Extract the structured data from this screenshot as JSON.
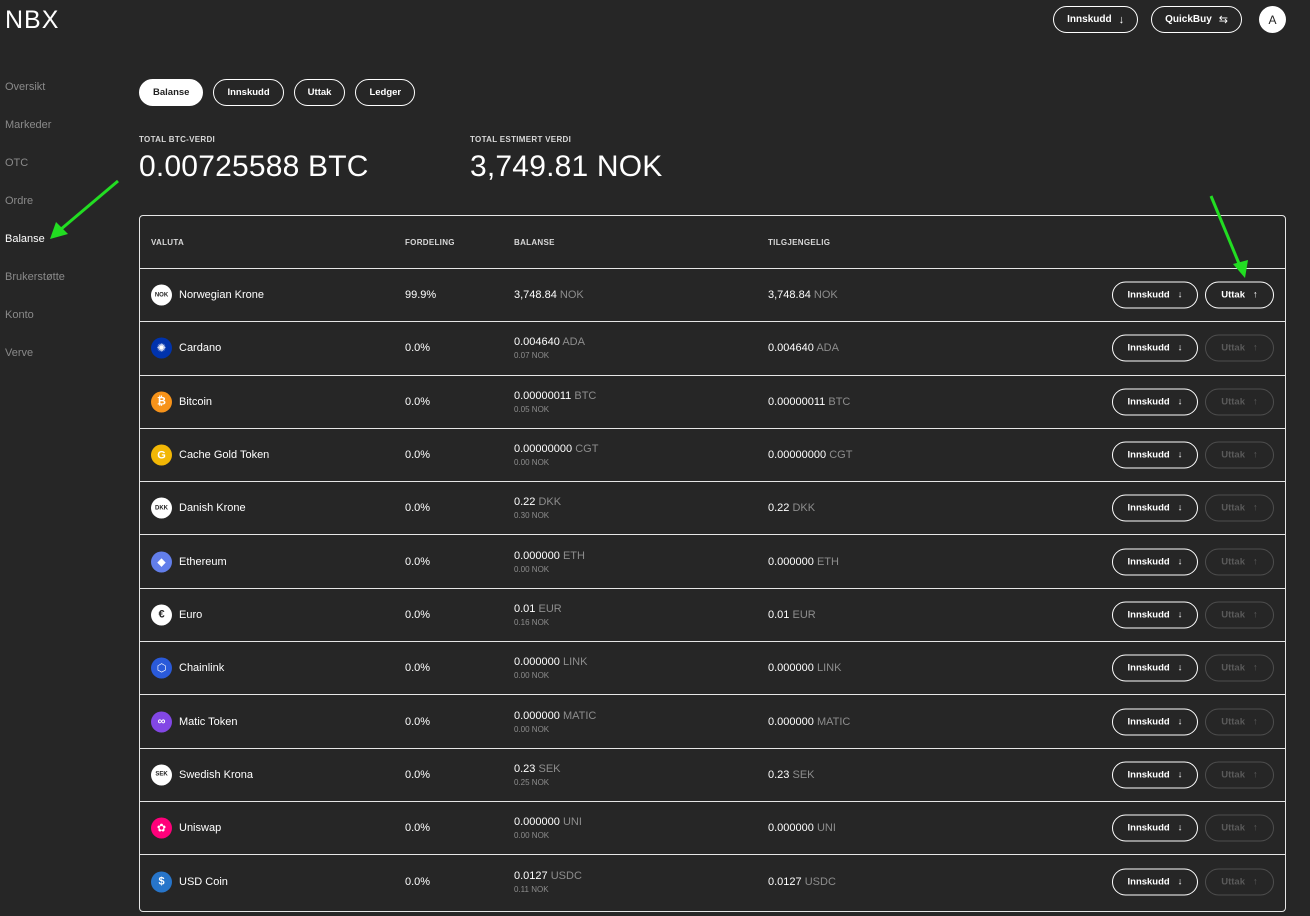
{
  "logo": "NBX",
  "header": {
    "deposit_label": "Innskudd",
    "deposit_icon": "arrow-down-icon",
    "quickbuy_label": "QuickBuy",
    "quickbuy_icon": "swap-icon",
    "avatar_initial": "A"
  },
  "sidebar": {
    "items": [
      {
        "label": "Oversikt",
        "active": false
      },
      {
        "label": "Markeder",
        "active": false
      },
      {
        "label": "OTC",
        "active": false
      },
      {
        "label": "Ordre",
        "active": false
      },
      {
        "label": "Balanse",
        "active": true
      },
      {
        "label": "Brukerstøtte",
        "active": false
      },
      {
        "label": "Konto",
        "active": false
      },
      {
        "label": "Verve",
        "active": false
      }
    ]
  },
  "tabs": [
    {
      "label": "Balanse",
      "active": true
    },
    {
      "label": "Innskudd",
      "active": false
    },
    {
      "label": "Uttak",
      "active": false
    },
    {
      "label": "Ledger",
      "active": false
    }
  ],
  "stats": {
    "btc_label": "TOTAL BTC-VERDI",
    "btc_value": "0.00725588 BTC",
    "est_label": "TOTAL ESTIMERT VERDI",
    "est_value": "3,749.81 NOK"
  },
  "table": {
    "headers": {
      "currency": "VALUTA",
      "share": "FORDELING",
      "balance": "BALANSE",
      "available": "TILGJENGELIG"
    },
    "deposit_label": "Innskudd",
    "withdraw_label": "Uttak",
    "rows": [
      {
        "icon": "nok-icon",
        "icon_text": "NOK",
        "icon_bg": "#ffffff",
        "icon_fg": "#222222",
        "name": "Norwegian Krone",
        "share": "99.9%",
        "balance": "3,748.84",
        "unit": "NOK",
        "sub": "",
        "available": "3,748.84",
        "withdraw_enabled": true
      },
      {
        "icon": "cardano-icon",
        "icon_text": "✺",
        "icon_bg": "#0033ad",
        "icon_fg": "#ffffff",
        "name": "Cardano",
        "share": "0.0%",
        "balance": "0.004640",
        "unit": "ADA",
        "sub": "0.07 NOK",
        "available": "0.004640",
        "withdraw_enabled": false
      },
      {
        "icon": "bitcoin-icon",
        "icon_text": "₿",
        "icon_bg": "#f7931a",
        "icon_fg": "#ffffff",
        "name": "Bitcoin",
        "share": "0.0%",
        "balance": "0.00000011",
        "unit": "BTC",
        "sub": "0.05 NOK",
        "available": "0.00000011",
        "withdraw_enabled": false
      },
      {
        "icon": "cache-gold-icon",
        "icon_text": "G",
        "icon_bg": "#f2b705",
        "icon_fg": "#ffffff",
        "name": "Cache Gold Token",
        "share": "0.0%",
        "balance": "0.00000000",
        "unit": "CGT",
        "sub": "0.00 NOK",
        "available": "0.00000000",
        "withdraw_enabled": false
      },
      {
        "icon": "dkk-icon",
        "icon_text": "DKK",
        "icon_bg": "#ffffff",
        "icon_fg": "#222222",
        "name": "Danish Krone",
        "share": "0.0%",
        "balance": "0.22",
        "unit": "DKK",
        "sub": "0.30 NOK",
        "available": "0.22",
        "withdraw_enabled": false
      },
      {
        "icon": "ethereum-icon",
        "icon_text": "◆",
        "icon_bg": "#627eea",
        "icon_fg": "#ffffff",
        "name": "Ethereum",
        "share": "0.0%",
        "balance": "0.000000",
        "unit": "ETH",
        "sub": "0.00 NOK",
        "available": "0.000000",
        "withdraw_enabled": false
      },
      {
        "icon": "euro-icon",
        "icon_text": "€",
        "icon_bg": "#ffffff",
        "icon_fg": "#222222",
        "name": "Euro",
        "share": "0.0%",
        "balance": "0.01",
        "unit": "EUR",
        "sub": "0.16 NOK",
        "available": "0.01",
        "withdraw_enabled": false
      },
      {
        "icon": "chainlink-icon",
        "icon_text": "⬡",
        "icon_bg": "#2a5ada",
        "icon_fg": "#ffffff",
        "name": "Chainlink",
        "share": "0.0%",
        "balance": "0.000000",
        "unit": "LINK",
        "sub": "0.00 NOK",
        "available": "0.000000",
        "withdraw_enabled": false
      },
      {
        "icon": "matic-icon",
        "icon_text": "∞",
        "icon_bg": "#8247e5",
        "icon_fg": "#ffffff",
        "name": "Matic Token",
        "share": "0.0%",
        "balance": "0.000000",
        "unit": "MATIC",
        "sub": "0.00 NOK",
        "available": "0.000000",
        "withdraw_enabled": false
      },
      {
        "icon": "sek-icon",
        "icon_text": "SEK",
        "icon_bg": "#ffffff",
        "icon_fg": "#222222",
        "name": "Swedish Krona",
        "share": "0.0%",
        "balance": "0.23",
        "unit": "SEK",
        "sub": "0.25 NOK",
        "available": "0.23",
        "withdraw_enabled": false
      },
      {
        "icon": "uniswap-icon",
        "icon_text": "✿",
        "icon_bg": "#ff007a",
        "icon_fg": "#ffffff",
        "name": "Uniswap",
        "share": "0.0%",
        "balance": "0.000000",
        "unit": "UNI",
        "sub": "0.00 NOK",
        "available": "0.000000",
        "withdraw_enabled": false
      },
      {
        "icon": "usdc-icon",
        "icon_text": "$",
        "icon_bg": "#2775ca",
        "icon_fg": "#ffffff",
        "name": "USD Coin",
        "share": "0.0%",
        "balance": "0.0127",
        "unit": "USDC",
        "sub": "0.11 NOK",
        "available": "0.0127",
        "withdraw_enabled": false
      }
    ]
  },
  "colors": {
    "background": "#262626",
    "annotation_arrow": "#22dd22",
    "muted_text": "#8d8d8d"
  }
}
